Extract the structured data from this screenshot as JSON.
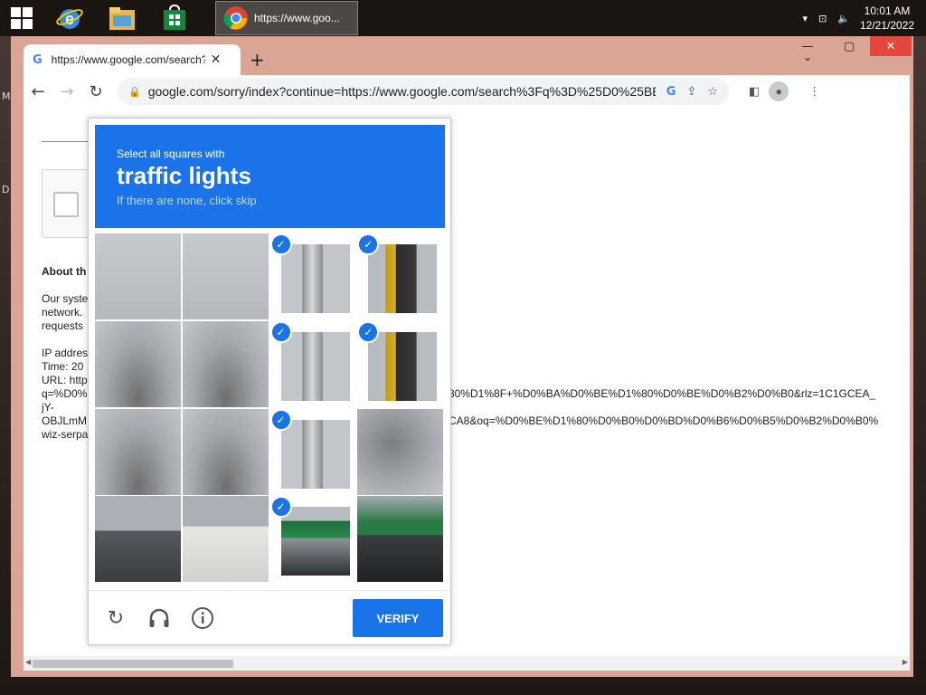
{
  "taskbar": {
    "chrome_label": "https://www.goo...",
    "clock_time": "10:01 AM",
    "clock_date": "12/21/2022"
  },
  "desktop": {
    "glyph_m": "M",
    "glyph_d": "D"
  },
  "browser": {
    "tab_title": "https://www.google.com/search?q=",
    "tab_favicon": "G",
    "new_tab": "+",
    "url": "google.com/sorry/index?continue=https://www.google.com/search%3Fq%3D%25D0%25BE%25D1%...",
    "omni_google": "G"
  },
  "page": {
    "about_heading": "About th",
    "body_lines": [
      "Our syste",
      "network.",
      "requests"
    ],
    "ip_line": "IP addres",
    "time_line": "Time: 20",
    "url_line": "URL: http",
    "q_line": "q=%D0%",
    "q_line_tail": "80%D1%8F+%D0%BA%D0%BE%D1%80%D0%BE%D0%B2%D0%B0&rlz=1C1GCEA_",
    "jy_line": "jY-",
    "objl_line": "OBJLmM",
    "objl_line_tail": "CA8&oq=%D0%BE%D1%80%D0%B0%D0%BD%D0%B6%D0%B5%D0%B2%D0%B0%",
    "wiz_line": "wiz-serpa"
  },
  "captcha": {
    "prompt_small": "Select all squares with",
    "prompt_big": "traffic lights",
    "prompt_skip": "If there are none, click skip",
    "verify_label": "VERIFY",
    "tiles": [
      {
        "img": "sky",
        "selected": false
      },
      {
        "img": "sky",
        "selected": false
      },
      {
        "img": "pole-top",
        "selected": true
      },
      {
        "img": "signal",
        "selected": true
      },
      {
        "img": "trees",
        "selected": false
      },
      {
        "img": "trees",
        "selected": false
      },
      {
        "img": "pole",
        "selected": true
      },
      {
        "img": "signal",
        "selected": true
      },
      {
        "img": "trees",
        "selected": false
      },
      {
        "img": "trees",
        "selected": false
      },
      {
        "img": "pole",
        "selected": true
      },
      {
        "img": "trees-dark",
        "selected": false
      },
      {
        "img": "house-r",
        "selected": false
      },
      {
        "img": "house-w",
        "selected": false
      },
      {
        "img": "sign",
        "selected": true
      },
      {
        "img": "sign-dark",
        "selected": false
      }
    ]
  },
  "colors": {
    "captcha_blue": "#1a73e8",
    "window_frame": "#dba596",
    "close_red": "#e4473c"
  }
}
